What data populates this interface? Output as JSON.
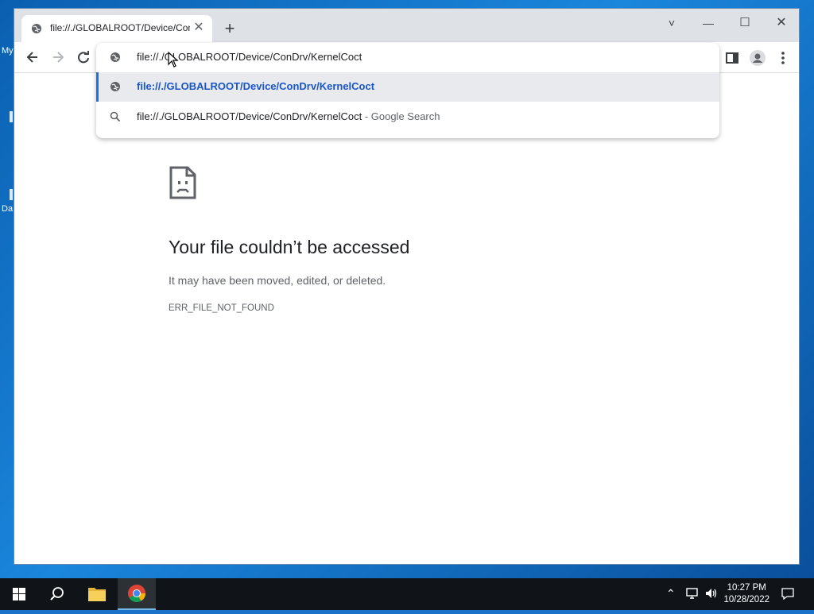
{
  "desktop": {
    "labels": [
      "My",
      "Da"
    ]
  },
  "tab": {
    "title": "file://./GLOBALROOT/Device/Con",
    "icon": "globe-icon"
  },
  "window_controls": {
    "tab_search": "˅",
    "minimize": "—",
    "maximize": "☐",
    "close": "✕"
  },
  "omnibox": {
    "input_text": "file://./GLOBALROOT/Device/ConDrv/KernelCoct",
    "suggestion_url": "file://./GLOBALROOT/Device/ConDrv/KernelCoct",
    "suggestion_search_query": "file://./GLOBALROOT/Device/ConDrv/KernelCoct",
    "suggestion_search_suffix": " - Google Search"
  },
  "error_page": {
    "title": "Your file couldn’t be accessed",
    "subtitle": "It may have been moved, edited, or deleted.",
    "code": "ERR_FILE_NOT_FOUND"
  },
  "taskbar": {
    "time": "10:27 PM",
    "date": "10/28/2022"
  },
  "colors": {
    "accent": "#1a73e8",
    "link": "#1a56c8",
    "taskbar": "#101418"
  }
}
